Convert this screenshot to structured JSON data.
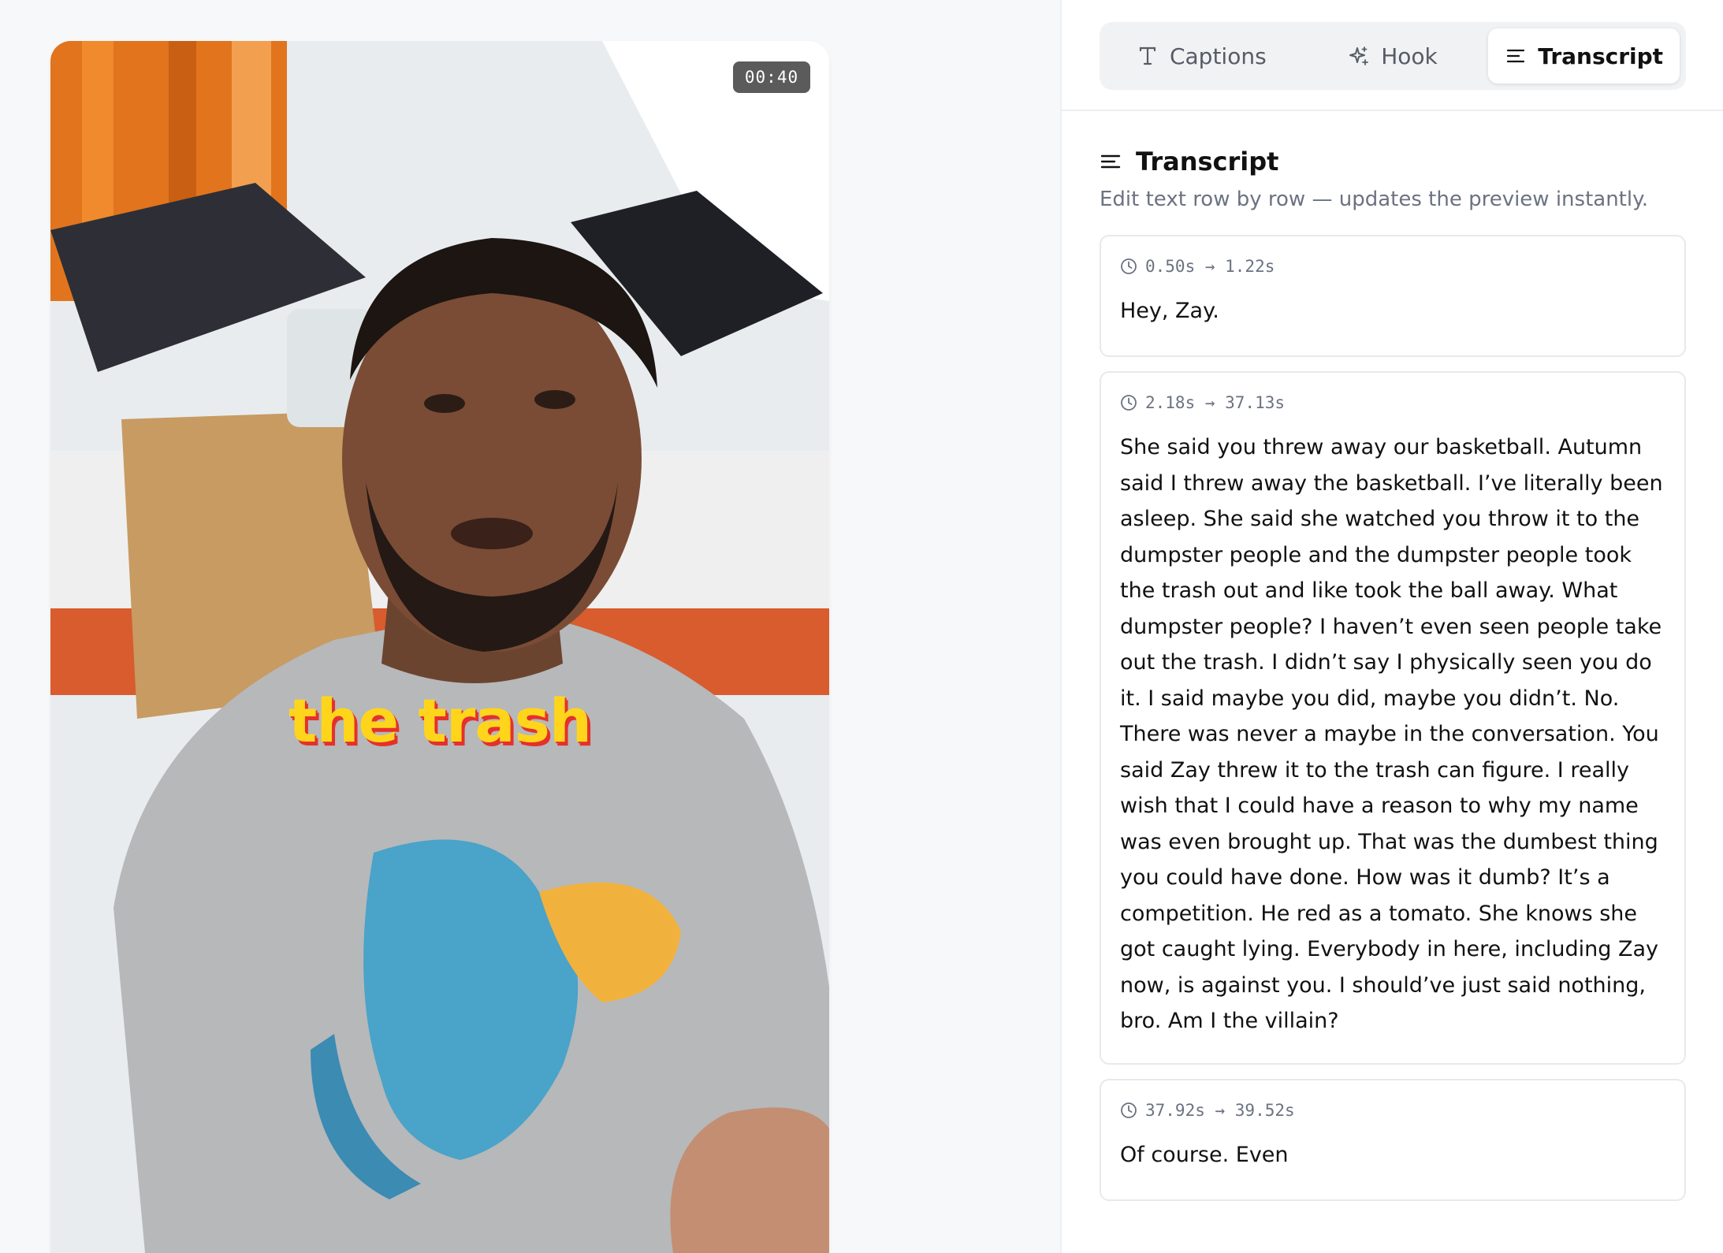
{
  "preview": {
    "timestamp": "00:40",
    "caption_word": "the trash",
    "caption_colors": {
      "fill": "#ffd51c",
      "shadow": "#e5302b"
    }
  },
  "tabs": [
    {
      "label": "Captions",
      "icon": "text-t-icon",
      "active": false
    },
    {
      "label": "Hook",
      "icon": "sparkle-icon",
      "active": false
    },
    {
      "label": "Transcript",
      "icon": "lines-icon",
      "active": true
    }
  ],
  "transcript": {
    "title": "Transcript",
    "subtitle": "Edit text row by row — updates the preview instantly.",
    "rows": [
      {
        "time": "0.50s → 1.22s",
        "text": "Hey, Zay."
      },
      {
        "time": "2.18s → 37.13s",
        "text": "She said you threw away our basketball. Autumn said I threw away the basketball. I’ve literally been asleep. She said she watched you throw it to the dumpster people and the dumpster people took the trash out and like took the ball away. What dumpster people? I haven’t even seen people take out the trash. I didn’t say I physically seen you do it. I said maybe you did, maybe you didn’t. No. There was never a maybe in the conversation. You said Zay threw it to the trash can figure. I really wish that I could have a reason to why my name was even brought up. That was the dumbest thing you could have done. How was it dumb? It’s a competition. He red as a tomato. She knows she got caught lying. Everybody in here, including Zay now, is against you. I should’ve just said nothing, bro. Am I the villain?"
      },
      {
        "time": "37.92s → 39.52s",
        "text": "Of course. Even"
      }
    ]
  }
}
